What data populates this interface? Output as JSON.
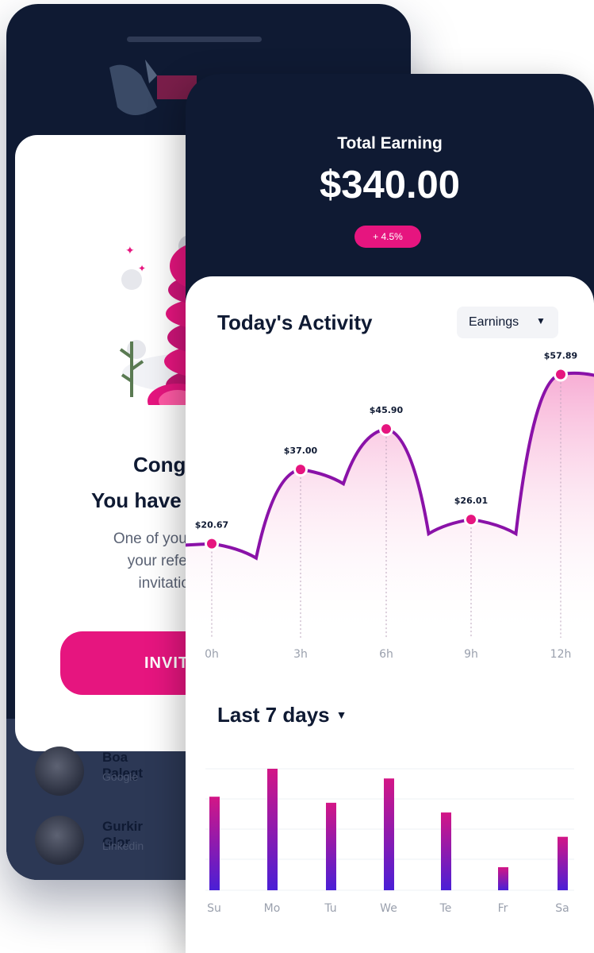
{
  "back_screen": {
    "congrats": {
      "title_line1": "Congra",
      "title_line2": "You have ju",
      "sub_line1": "One of your fr",
      "sub_line2": "your referra",
      "sub_line3": "invitations"
    },
    "invite_button": "INVIT",
    "referrals": [
      {
        "name": "Boa Palegt",
        "source": "Google"
      },
      {
        "name": "Gurkir Glor",
        "source": "Linkedin"
      }
    ]
  },
  "earnings": {
    "label": "Total Earning",
    "amount": "$340.00",
    "change": "+ 4.5%"
  },
  "activity": {
    "title": "Today's Activity",
    "dropdown_value": "Earnings"
  },
  "last7": {
    "title": "Last 7 days"
  },
  "colors": {
    "navy": "#0f1a33",
    "accent": "#e6157f",
    "line": "#8a12a8",
    "bar_top": "#d31686",
    "bar_bottom": "#4a1fd6"
  },
  "chart_data": [
    {
      "type": "area",
      "title": "",
      "x": [
        "0h",
        "3h",
        "6h",
        "9h",
        "12h"
      ],
      "series": [
        {
          "values": [
            20.67,
            37.0,
            45.9,
            26.01,
            57.89
          ]
        }
      ],
      "data_labels": [
        "$20.67",
        "$37.00",
        "$45.90",
        "$26.01",
        "$57.89"
      ],
      "ylim": [
        0,
        62
      ],
      "grid": false
    },
    {
      "type": "bar",
      "categories": [
        "Su",
        "Mo",
        "Tu",
        "We",
        "Te",
        "Fr",
        "Sa"
      ],
      "values": [
        77,
        100,
        72,
        92,
        64,
        19,
        44
      ],
      "ylim": [
        0,
        100
      ],
      "grid": true
    }
  ]
}
